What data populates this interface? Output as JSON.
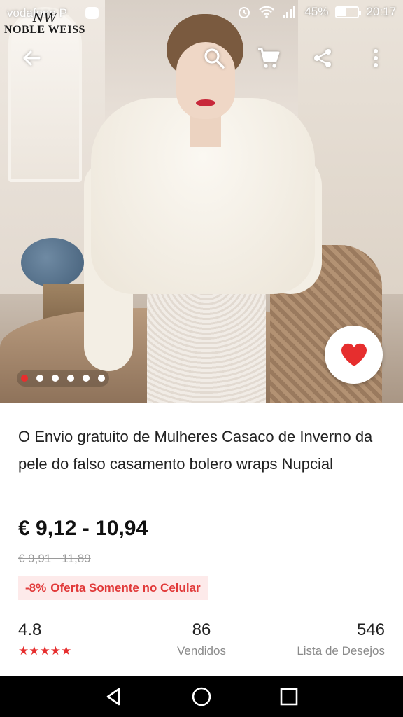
{
  "status_bar": {
    "carrier": "vodafone P",
    "battery_percent": "45%",
    "battery_level": 0.45,
    "time": "20:17"
  },
  "brand": {
    "monogram": "NW",
    "name": "NOBLE WEISS"
  },
  "toolbar": {
    "icons": [
      "back-arrow-icon",
      "search-icon",
      "cart-icon",
      "share-icon",
      "more-vert-icon"
    ]
  },
  "gallery": {
    "dot_count": 6,
    "active_index": 0,
    "accent_color": "#e62e2e"
  },
  "product": {
    "title": "O Envio gratuito de Mulheres Casaco de Inverno da pele do falso casamento bolero wraps Nupcial",
    "price": "€ 9,12 - 10,94",
    "original_price": "€ 9,91 - 11,89",
    "promo_discount": "-8%",
    "promo_text": "Oferta Somente no Celular"
  },
  "stats": {
    "rating": "4.8",
    "rating_stars": 5,
    "sold_count": "86",
    "sold_label": "Vendidos",
    "wishlist_count": "546",
    "wishlist_label": "Lista de Desejos"
  },
  "navbar": {
    "icons": [
      "back-triangle-icon",
      "home-circle-icon",
      "recents-square-icon"
    ]
  },
  "colors": {
    "accent": "#e62e2e",
    "promo_bg": "#fdeaea"
  }
}
